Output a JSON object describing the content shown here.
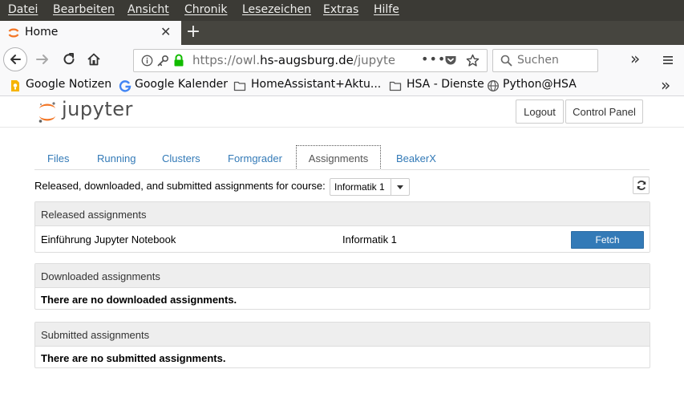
{
  "menu": {
    "items": [
      "Datei",
      "Bearbeiten",
      "Ansicht",
      "Chronik",
      "Lesezeichen",
      "Extras",
      "Hilfe"
    ]
  },
  "browser": {
    "tab_title": "Home",
    "new_tab": "+",
    "url_scheme": "https://owl.",
    "url_domain": "hs-augsburg.de",
    "url_path": "/jupyter/u",
    "search_placeholder": "Suchen",
    "overflow": "»",
    "menu_icon": "hamburger-icon",
    "bookmarks": [
      "Google Notizen",
      "Google Kalender",
      "HomeAssistant+Aktu...",
      "HSA - Dienste",
      "Python@HSA"
    ],
    "bookmarks_overflow": "»"
  },
  "colors": {
    "menubar": "#3b3a35",
    "tabstrip": "#46453f",
    "link": "#337ab7",
    "primary_button": "#337ab7",
    "jupyter_orange": "#f37626"
  },
  "header": {
    "logo_text": "jupyter",
    "logout_label": "Logout",
    "control_panel_label": "Control Panel"
  },
  "tabs": {
    "files": "Files",
    "running": "Running",
    "clusters": "Clusters",
    "formgrader": "Formgrader",
    "assignments": "Assignments",
    "beakerx": "BeakerX",
    "active": "Assignments"
  },
  "course": {
    "label": "Released, downloaded, and submitted assignments for course:",
    "selected": "Informatik 1"
  },
  "released": {
    "heading": "Released assignments",
    "rows": [
      {
        "name": "Einführung Jupyter Notebook",
        "course": "Informatik 1",
        "action": "Fetch"
      }
    ]
  },
  "downloaded": {
    "heading": "Downloaded assignments",
    "empty": "There are no downloaded assignments."
  },
  "submitted": {
    "heading": "Submitted assignments",
    "empty": "There are no submitted assignments."
  }
}
